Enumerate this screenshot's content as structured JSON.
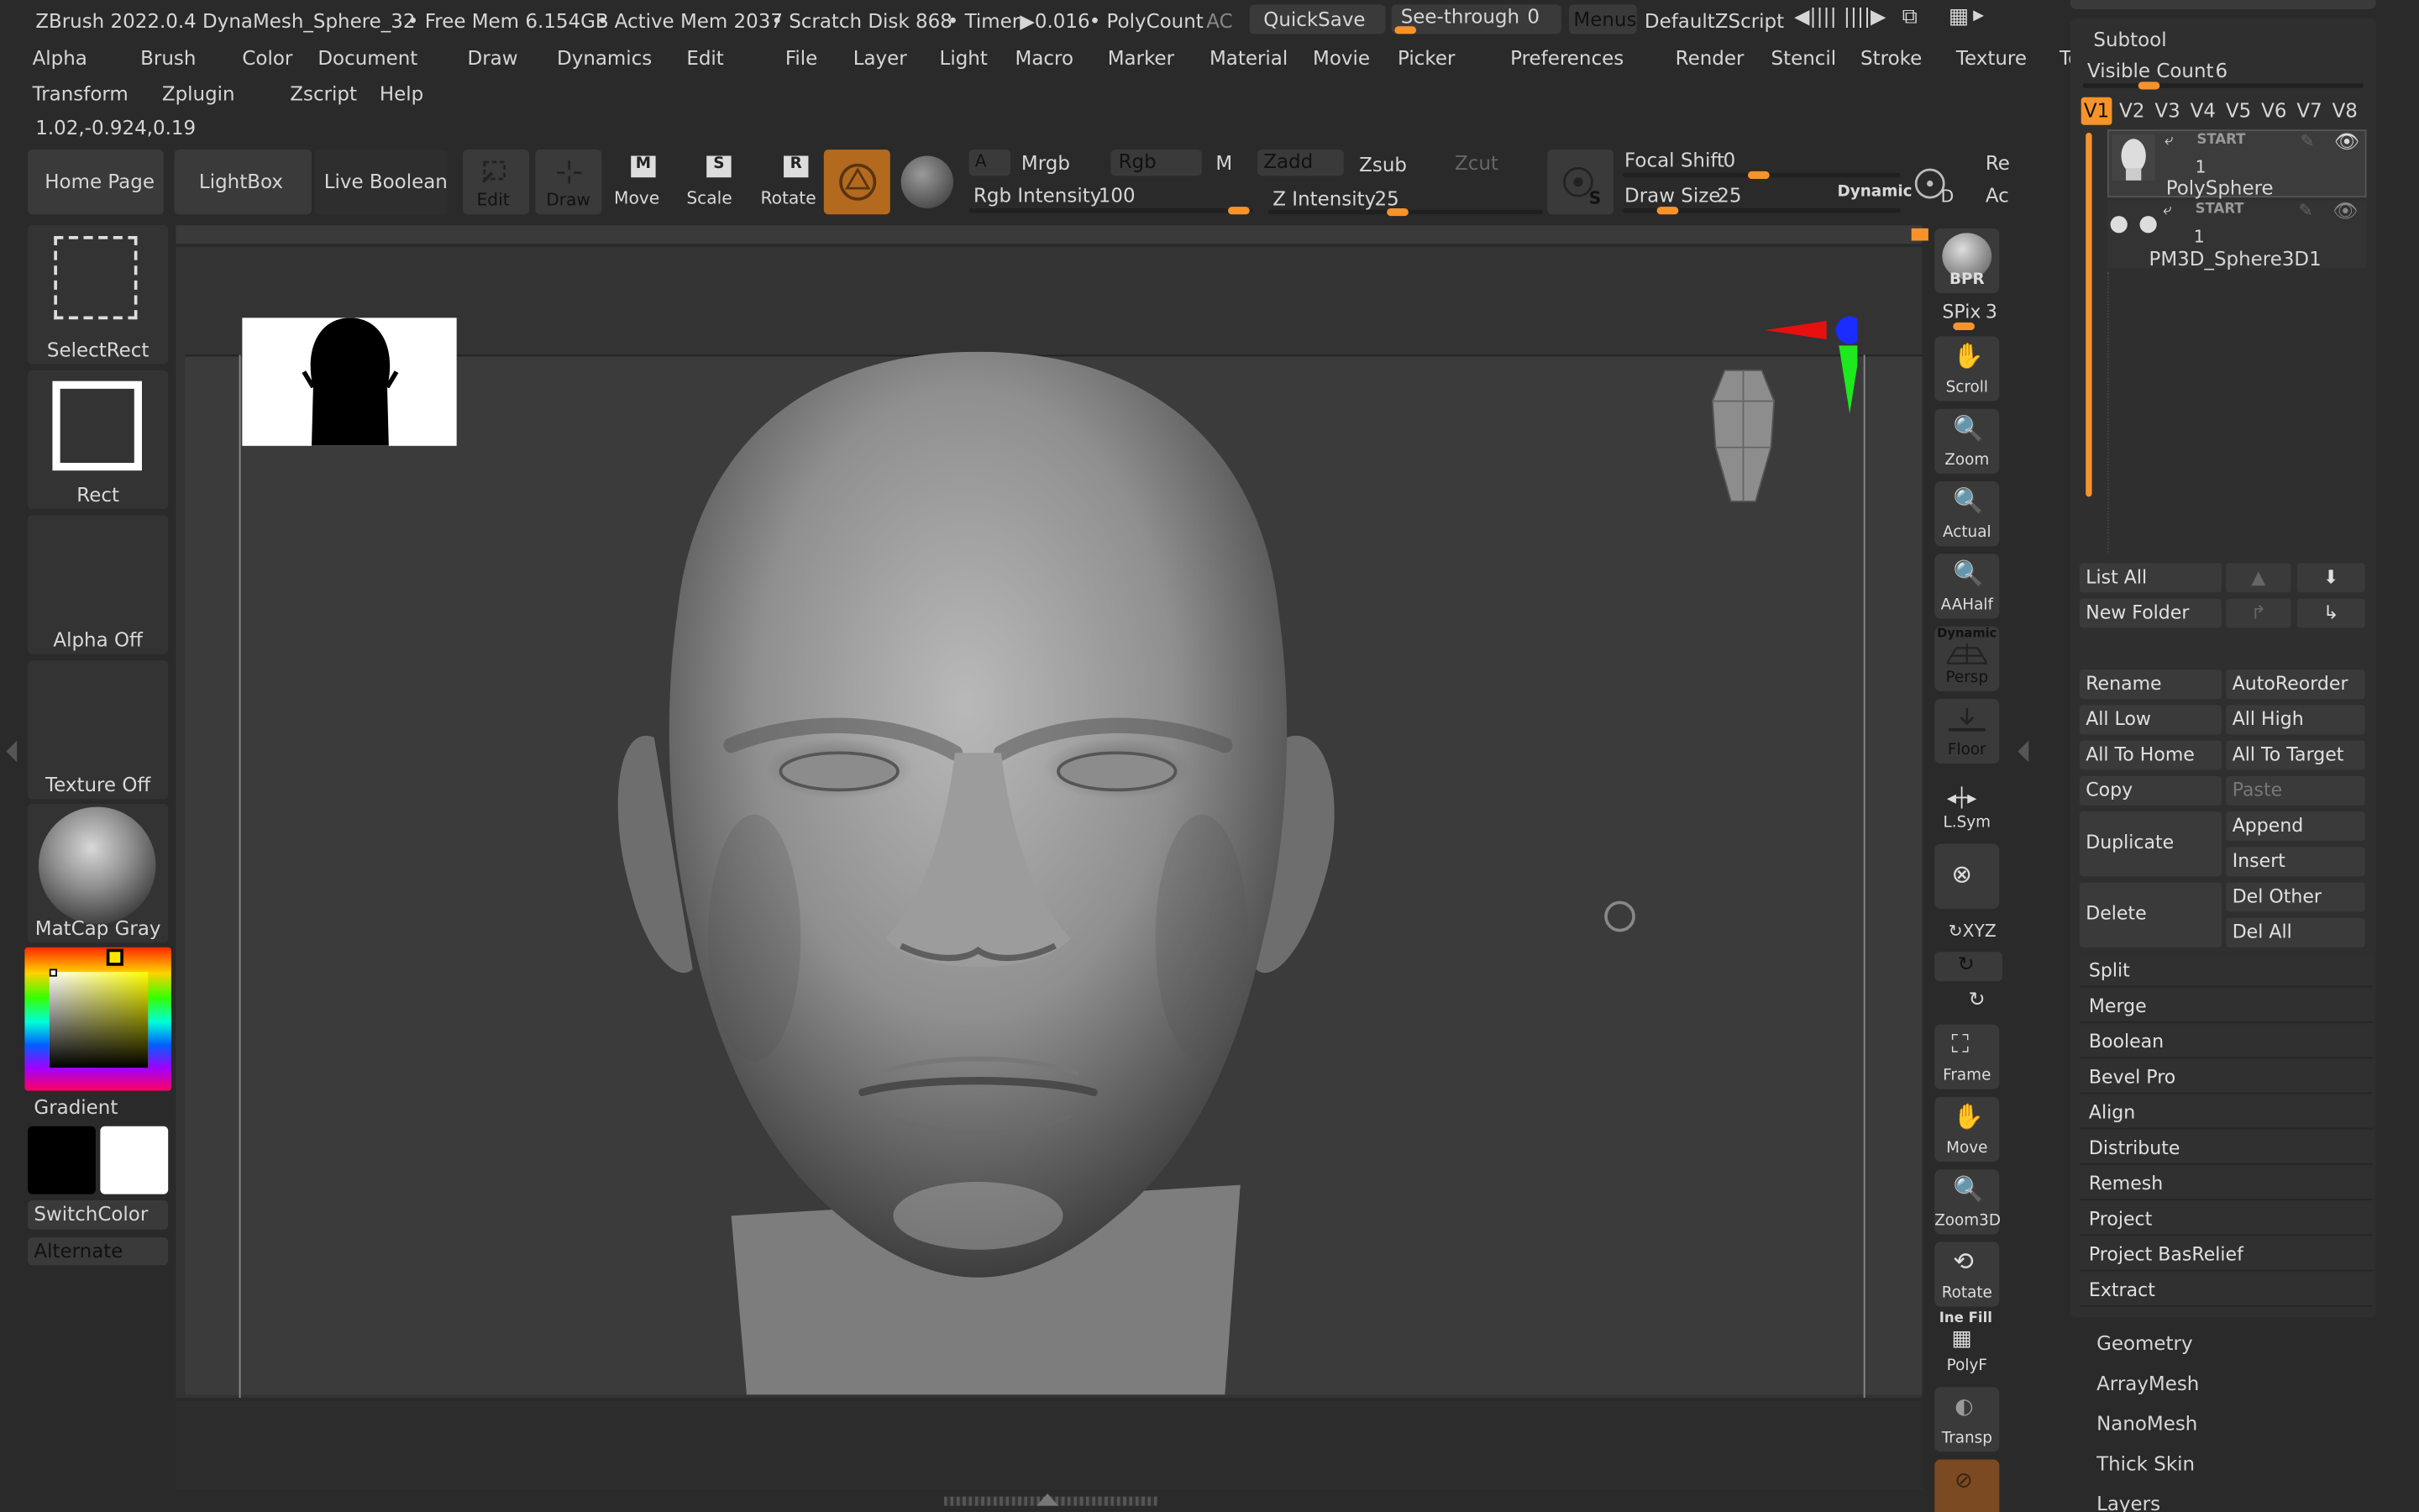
{
  "titlebar": {
    "app_title": "ZBrush 2022.0.4 DynaMesh_Sphere_32",
    "free_mem": "• Free Mem 6.154GB",
    "active_mem": "• Active Mem 2037",
    "scratch_disk": "• Scratch Disk 868",
    "timer": "• Timer▶0.016",
    "polycount": "• PolyCount",
    "ac": "AC",
    "quicksave": "QuickSave",
    "see_through_label": "See-through",
    "see_through_value": "0",
    "menus": "Menus",
    "zscript": "DefaultZScript"
  },
  "menu_row1": [
    "Alpha",
    "Brush",
    "Color",
    "Document",
    "Draw",
    "Dynamics",
    "Edit",
    "File",
    "Layer",
    "Light",
    "Macro",
    "Marker",
    "Material",
    "Movie",
    "Picker",
    "Preferences",
    "Render",
    "Stencil",
    "Stroke",
    "Texture",
    "Tool"
  ],
  "menu_row2": [
    "Transform",
    "Zplugin",
    "Zscript",
    "Help"
  ],
  "coords": "1.02,-0.924,0.19",
  "toolbar": {
    "home_page": "Home Page",
    "lightbox": "LightBox",
    "live_boolean": "Live Boolean",
    "edit": "Edit",
    "draw": "Draw",
    "move": "Move",
    "scale": "Scale",
    "rotate": "Rotate",
    "a": "A",
    "mrgb": "Mrgb",
    "rgb": "Rgb",
    "m": "M",
    "zadd": "Zadd",
    "zsub": "Zsub",
    "zcut": "Zcut",
    "rgb_intensity_label": "Rgb Intensity",
    "rgb_intensity_value": "100",
    "z_intensity_label": "Z Intensity",
    "z_intensity_value": "25",
    "focal_shift_label": "Focal Shift",
    "focal_shift_value": "0",
    "draw_size_label": "Draw Size",
    "draw_size_value": "25",
    "dynamic": "Dynamic",
    "re": "Re",
    "ac": "Ac",
    "d": "D",
    "s": "S"
  },
  "left_panel": {
    "select_rect": "SelectRect",
    "rect": "Rect",
    "alpha_off": "Alpha Off",
    "texture_off": "Texture Off",
    "matcap": "MatCap Gray",
    "gradient": "Gradient",
    "switch_color": "SwitchColor",
    "alternate": "Alternate"
  },
  "right_shelf": {
    "bpr": "BPR",
    "spix_label": "SPix",
    "spix_value": "3",
    "scroll": "Scroll",
    "zoom": "Zoom",
    "actual": "Actual",
    "aahalf": "AAHalf",
    "dynamic": "Dynamic",
    "persp": "Persp",
    "floor": "Floor",
    "lsym": "L.Sym",
    "xyz": "XYZ",
    "frame": "Frame",
    "move": "Move",
    "zoom3d": "Zoom3D",
    "rotate": "Rotate",
    "ine_fill": "Ine Fill",
    "polyf": "PolyF",
    "transp": "Transp"
  },
  "subtool": {
    "title": "Subtool",
    "visible_count_label": "Visible Count",
    "visible_count_value": "6",
    "versions": [
      "V1",
      "V2",
      "V3",
      "V4",
      "V5",
      "V6",
      "V7",
      "V8"
    ],
    "items": [
      {
        "start": "START",
        "num": "1",
        "name": "PolySphere"
      },
      {
        "start": "START",
        "num": "1",
        "name": "PM3D_Sphere3D1"
      }
    ],
    "list_all": "List All",
    "new_folder": "New Folder",
    "rename": "Rename",
    "auto_reorder": "AutoReorder",
    "all_low": "All Low",
    "all_high": "All High",
    "all_to_home": "All To Home",
    "all_to_target": "All To Target",
    "copy": "Copy",
    "paste": "Paste",
    "duplicate": "Duplicate",
    "append": "Append",
    "insert": "Insert",
    "delete": "Delete",
    "del_other": "Del Other",
    "del_all": "Del All",
    "sections": [
      "Split",
      "Merge",
      "Boolean",
      "Bevel Pro",
      "Align",
      "Distribute",
      "Remesh",
      "Project",
      "Project BasRelief",
      "Extract"
    ],
    "subpalettes": [
      "Geometry",
      "ArrayMesh",
      "NanoMesh",
      "Thick Skin",
      "Layers"
    ]
  },
  "colors": {
    "accent": "#f7932a",
    "background": "#2a2a2a",
    "canvas": "#3b3b3b"
  }
}
